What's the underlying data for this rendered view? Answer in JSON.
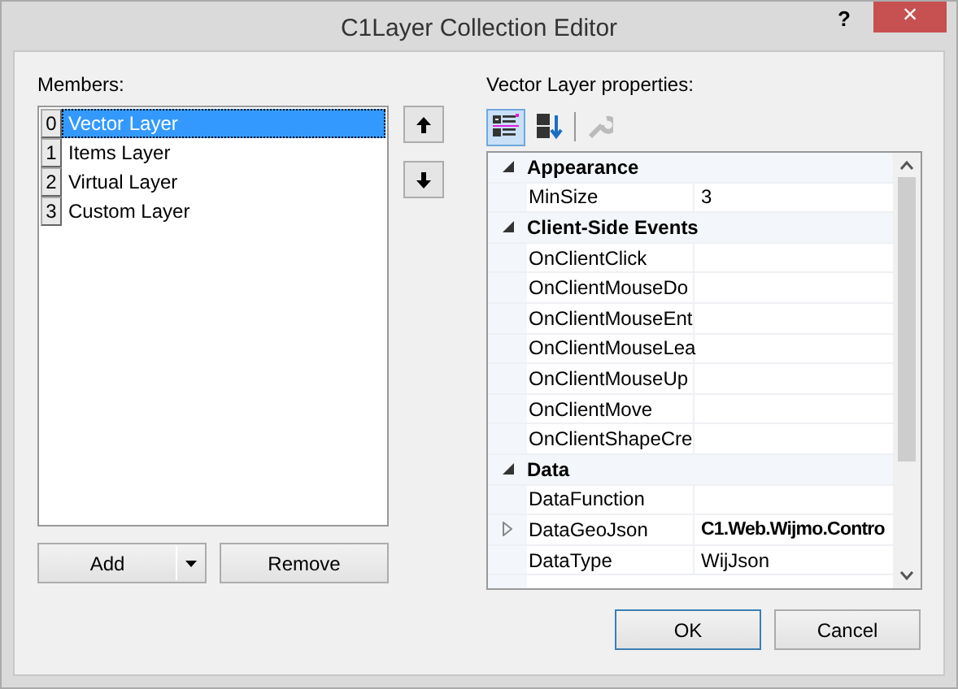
{
  "window": {
    "title": "C1Layer Collection Editor",
    "help": "?",
    "close": "×"
  },
  "members": {
    "label": "Members:",
    "items": [
      {
        "index": "0",
        "name": "Vector Layer",
        "selected": true
      },
      {
        "index": "1",
        "name": "Items Layer",
        "selected": false
      },
      {
        "index": "2",
        "name": "Virtual Layer",
        "selected": false
      },
      {
        "index": "3",
        "name": "Custom Layer",
        "selected": false
      }
    ]
  },
  "member_buttons": {
    "add": "Add",
    "remove": "Remove"
  },
  "properties": {
    "label": "Vector Layer properties:",
    "toolbar": [
      {
        "kind": "categorized",
        "selected": true
      },
      {
        "kind": "alphabetical",
        "selected": false
      },
      {
        "kind": "property-pages",
        "disabled": true
      }
    ],
    "rows": [
      {
        "kind": "category",
        "name": "Appearance",
        "expanded": true
      },
      {
        "kind": "property",
        "name": "MinSize",
        "value": "3",
        "modified": false,
        "expandable": false
      },
      {
        "kind": "category",
        "name": "Client-Side Events",
        "expanded": true
      },
      {
        "kind": "property",
        "name": "OnClientClick",
        "expandable": false
      },
      {
        "kind": "property",
        "name": "OnClientMouseDo",
        "expandable": false
      },
      {
        "kind": "property",
        "name": "OnClientMouseEnt",
        "expandable": false
      },
      {
        "kind": "property",
        "name": "OnClientMouseLea",
        "expandable": false
      },
      {
        "kind": "property",
        "name": "OnClientMouseUp",
        "expandable": false
      },
      {
        "kind": "property",
        "name": "OnClientMove",
        "expandable": false
      },
      {
        "kind": "property",
        "name": "OnClientShapeCre",
        "expandable": false
      },
      {
        "kind": "category",
        "name": "Data",
        "expanded": true
      },
      {
        "kind": "property",
        "name": "DataFunction",
        "expandable": false
      },
      {
        "kind": "property",
        "name": "DataGeoJson",
        "value": "C1.Web.Wijmo.Contro",
        "modified": true,
        "expandable": true
      },
      {
        "kind": "property",
        "name": "DataType",
        "value": "WijJson",
        "modified": false,
        "expandable": false
      }
    ]
  },
  "buttons": {
    "ok": "OK",
    "cancel": "Cancel"
  }
}
